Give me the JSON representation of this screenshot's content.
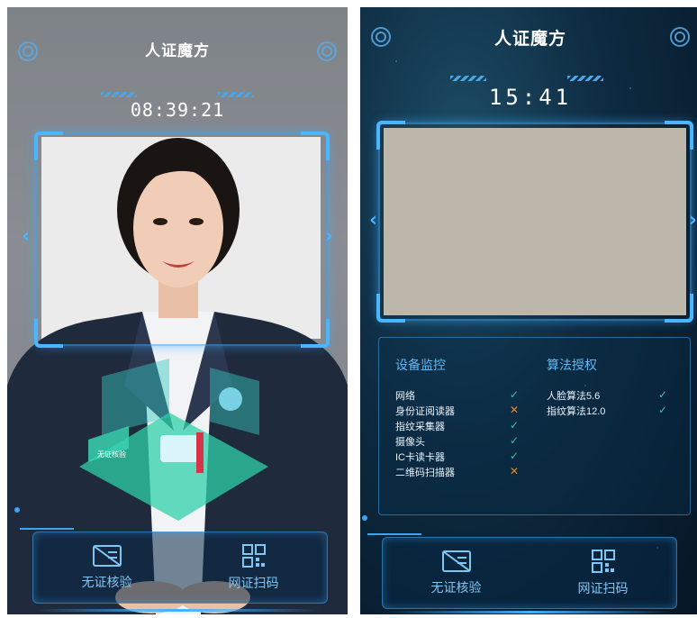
{
  "left_screen": {
    "title": "人证魔方",
    "time": "08:39:21",
    "buttons": [
      {
        "label": "无证核验",
        "icon": "id-card-cross-icon"
      },
      {
        "label": "网证扫码",
        "icon": "qr-code-icon"
      }
    ],
    "hologram_badge": "无证核验"
  },
  "right_screen": {
    "title": "人证魔方",
    "time": "15:41",
    "device_monitor": {
      "title": "设备监控",
      "items": [
        {
          "label": "网络",
          "status": "✓"
        },
        {
          "label": "身份证阅读器",
          "status": "✕"
        },
        {
          "label": "指纹采集器",
          "status": "✓"
        },
        {
          "label": "摄像头",
          "status": "✓"
        },
        {
          "label": "IC卡读卡器",
          "status": "✓"
        },
        {
          "label": "二维码扫描器",
          "status": "✕"
        }
      ]
    },
    "algorithm_auth": {
      "title": "算法授权",
      "items": [
        {
          "label": "人脸算法5.6",
          "status": "✓"
        },
        {
          "label": "指纹算法12.0",
          "status": "✓"
        }
      ]
    },
    "buttons": [
      {
        "label": "无证核验",
        "icon": "id-card-cross-icon"
      },
      {
        "label": "网证扫码",
        "icon": "qr-code-icon"
      }
    ]
  },
  "colors": {
    "accent": "#49b6ff",
    "ok": "#3fbf9f",
    "fail": "#e58a2a",
    "bg_dark": "#0d2a40"
  }
}
